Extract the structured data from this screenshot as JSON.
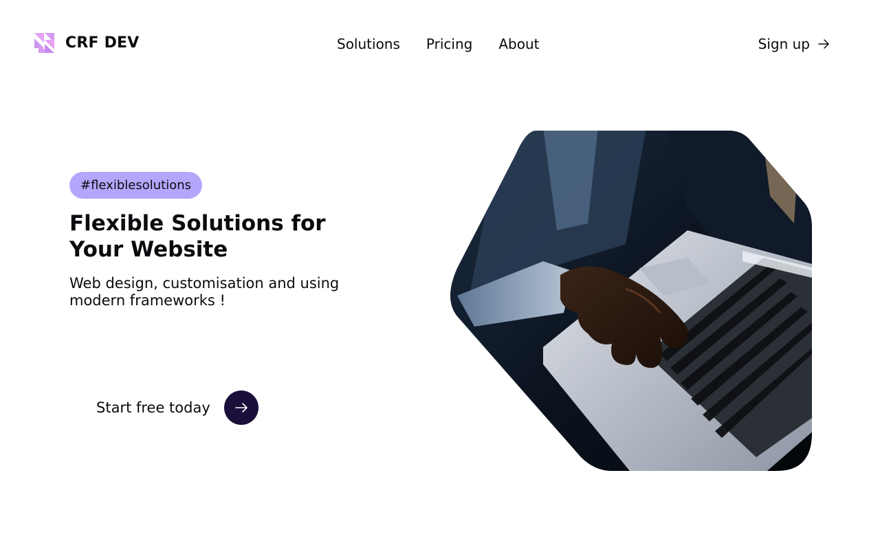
{
  "brand": {
    "name": "CRF DEV",
    "logo_icon": "stacked-triangles-logo",
    "logo_colors": [
      "#e6a1f2",
      "#c48bf0"
    ]
  },
  "nav": {
    "items": [
      {
        "label": "Solutions"
      },
      {
        "label": "Pricing"
      },
      {
        "label": "About"
      }
    ]
  },
  "header": {
    "signup_label": "Sign up",
    "signup_icon": "arrow-right-icon"
  },
  "hero": {
    "tag": "#flexiblesolutions",
    "headline": "Flexible Solutions for Your Website",
    "subline": "Web design, customisation and using modern frameworks !",
    "cta_label": "Start free today",
    "cta_icon": "arrow-right-icon",
    "image_icon": "person-typing-laptop-image"
  },
  "colors": {
    "tag_bg": "#b5a6fb",
    "cta_circle": "#1a0f3b",
    "text": "#0b0b0f"
  }
}
